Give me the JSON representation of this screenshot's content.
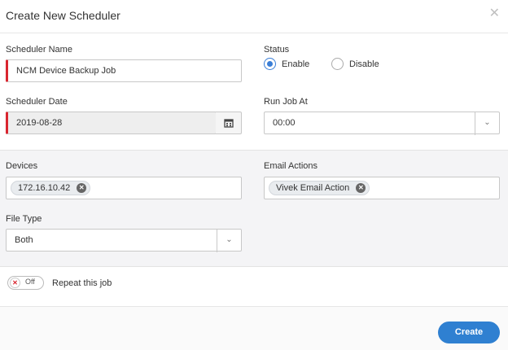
{
  "dialog": {
    "title": "Create New Scheduler",
    "close_icon": "close-icon"
  },
  "form": {
    "scheduler_name": {
      "label": "Scheduler Name",
      "value": "NCM Device Backup Job"
    },
    "status": {
      "label": "Status",
      "options": [
        "Enable",
        "Disable"
      ],
      "selected": "Enable"
    },
    "scheduler_date": {
      "label": "Scheduler Date",
      "value": "2019-08-28"
    },
    "run_job_at": {
      "label": "Run Job At",
      "value": "00:00"
    },
    "devices": {
      "label": "Devices",
      "chips": [
        "172.16.10.42"
      ]
    },
    "email_actions": {
      "label": "Email Actions",
      "chips": [
        "Vivek Email Action"
      ]
    },
    "file_type": {
      "label": "File Type",
      "value": "Both"
    },
    "repeat": {
      "toggle_state": "Off",
      "label": "Repeat this job"
    }
  },
  "footer": {
    "create_label": "Create"
  },
  "colors": {
    "accent": "#2f80d1",
    "required": "#d9252f"
  }
}
